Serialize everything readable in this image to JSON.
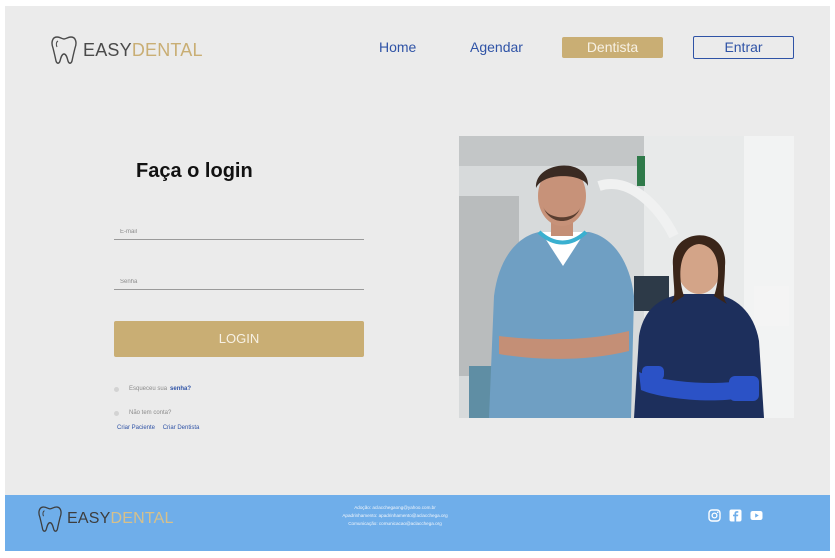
{
  "header": {
    "logo": {
      "text_part1": "EASY",
      "text_part2": "DENTAL"
    },
    "nav": {
      "home": "Home",
      "agendar": "Agendar",
      "dentista": "Dentista",
      "entrar": "Entrar"
    }
  },
  "login": {
    "title": "Faça o login",
    "email_placeholder": "E-mail",
    "password_placeholder": "Senha",
    "button": "LOGIN",
    "forgot_text": "Esqueceu sua",
    "forgot_link": "senha?",
    "no_account_text": "Não tem conta?",
    "create_patient": "Criar Paciente",
    "create_dentist": "Criar Dentista"
  },
  "footer": {
    "logo": {
      "text_part1": "EASY",
      "text_part2": "DENTAL"
    },
    "contacts": [
      "Adoção: aclacchegaong@yahoo.com.br",
      "Apadrinhamento: apadrinhamento@aclacchega.org",
      "Comunicação: comunicacao@aclacchega.org"
    ],
    "social_icons": [
      "instagram-icon",
      "facebook-icon",
      "youtube-icon"
    ]
  },
  "colors": {
    "gold": "#c9ae74",
    "blue": "#2f53a6",
    "footer_blue": "#6faeea",
    "background": "#ebebeb"
  }
}
